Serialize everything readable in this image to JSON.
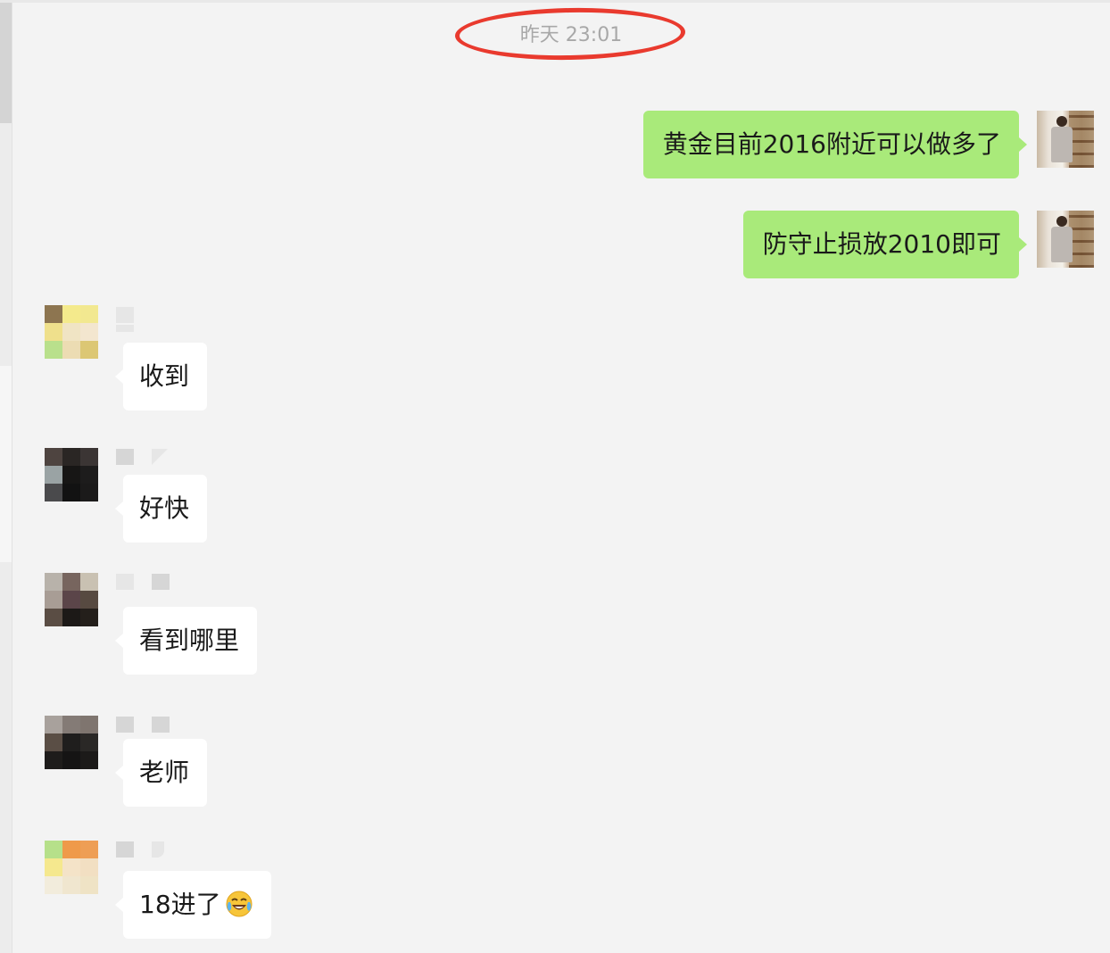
{
  "timestamp": "昨天 23:01",
  "messages": [
    {
      "direction": "out",
      "text": "黄金目前2016附近可以做多了"
    },
    {
      "direction": "out",
      "text": "防守止损放2010即可"
    },
    {
      "direction": "in",
      "text": "收到"
    },
    {
      "direction": "in",
      "text": "好快"
    },
    {
      "direction": "in",
      "text": "看到哪里"
    },
    {
      "direction": "in",
      "text": "老师"
    },
    {
      "direction": "in",
      "text": "18进了"
    }
  ],
  "colors": {
    "outgoing_bubble": "#a9ea7a",
    "incoming_bubble": "#ffffff",
    "background": "#f3f3f3",
    "timestamp_text": "#a8a8a8",
    "highlight_circle": "#e93a2e"
  },
  "icons": {
    "emoji_in_last_message": "face-with-tears-of-joy-icon"
  }
}
